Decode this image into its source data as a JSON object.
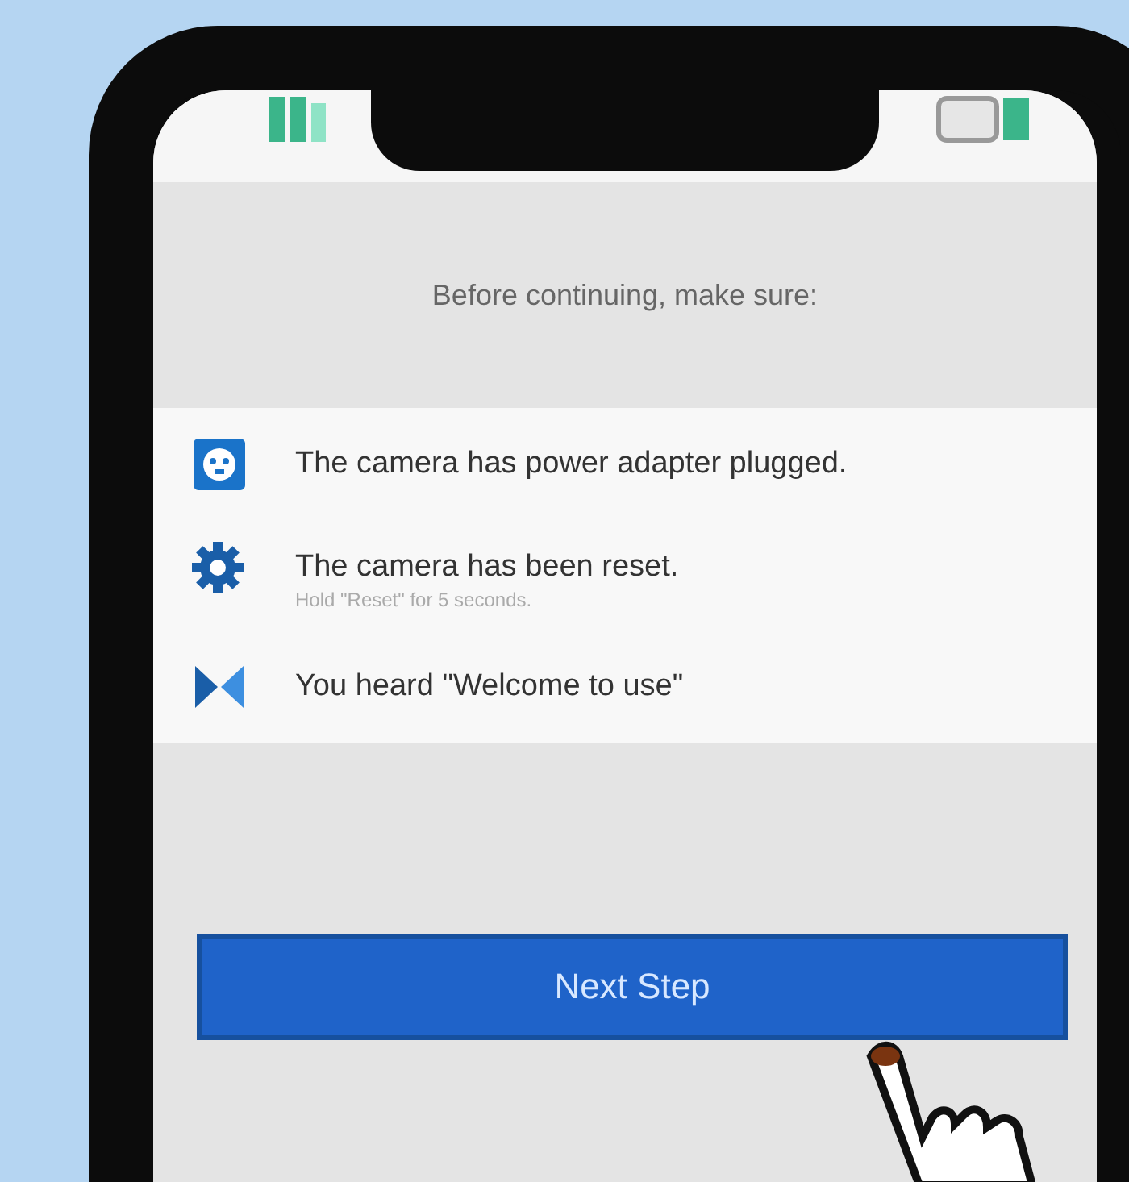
{
  "header": {
    "title": "Before continuing, make sure:"
  },
  "checklist": [
    {
      "kind": "plug",
      "text": "The camera has power adapter plugged."
    },
    {
      "kind": "gear",
      "text": "The camera has been reset.",
      "hint": "Hold \"Reset\" for 5 seconds."
    },
    {
      "kind": "sound",
      "text": "You heard \"Welcome to use\""
    }
  ],
  "button": {
    "label": "Next Step"
  }
}
